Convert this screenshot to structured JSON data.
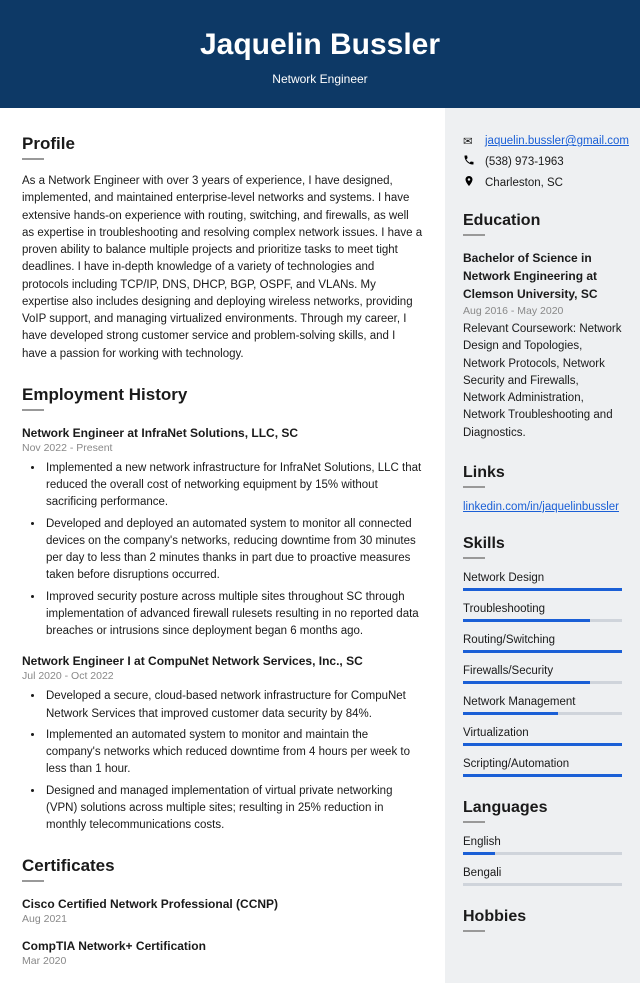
{
  "header": {
    "name": "Jaquelin Bussler",
    "title": "Network Engineer"
  },
  "profile": {
    "heading": "Profile",
    "text": "As a Network Engineer with over 3 years of experience, I have designed, implemented, and maintained enterprise-level networks and systems. I have extensive hands-on experience with routing, switching, and firewalls, as well as expertise in troubleshooting and resolving complex network issues. I have a proven ability to balance multiple projects and prioritize tasks to meet tight deadlines. I have in-depth knowledge of a variety of technologies and protocols including TCP/IP, DNS, DHCP, BGP, OSPF, and VLANs. My expertise also includes designing and deploying wireless networks, providing VoIP support, and managing virtualized environments. Through my career, I have developed strong customer service and problem-solving skills, and I have a passion for working with technology."
  },
  "employment": {
    "heading": "Employment History",
    "jobs": [
      {
        "title": "Network Engineer at InfraNet Solutions, LLC, SC",
        "dates": "Nov 2022 - Present",
        "bullets": [
          "Implemented a new network infrastructure for InfraNet Solutions, LLC that reduced the overall cost of networking equipment by 15% without sacrificing performance.",
          "Developed and deployed an automated system to monitor all connected devices on the company's networks, reducing downtime from 30 minutes per day to less than 2 minutes thanks in part due to proactive measures taken before disruptions occurred.",
          "Improved security posture across multiple sites throughout SC through implementation of advanced firewall rulesets resulting in no reported data breaches or intrusions since deployment began 6 months ago."
        ]
      },
      {
        "title": "Network Engineer I at CompuNet Network Services, Inc., SC",
        "dates": "Jul 2020 - Oct 2022",
        "bullets": [
          "Developed a secure, cloud-based network infrastructure for CompuNet Network Services that improved customer data security by 84%.",
          "Implemented an automated system to monitor and maintain the company's networks which reduced downtime from 4 hours per week to less than 1 hour.",
          "Designed and managed implementation of virtual private networking (VPN) solutions across multiple sites; resulting in 25% reduction in monthly telecommunications costs."
        ]
      }
    ]
  },
  "certificates": {
    "heading": "Certificates",
    "items": [
      {
        "title": "Cisco Certified Network Professional (CCNP)",
        "date": "Aug 2021"
      },
      {
        "title": "CompTIA Network+ Certification",
        "date": "Mar 2020"
      }
    ]
  },
  "contact": {
    "email": "jaquelin.bussler@gmail.com",
    "phone": "(538) 973-1963",
    "location": "Charleston, SC"
  },
  "education": {
    "heading": "Education",
    "title": "Bachelor of Science in Network Engineering at Clemson University, SC",
    "dates": "Aug 2016 - May 2020",
    "desc": "Relevant Coursework: Network Design and Topologies, Network Protocols, Network Security and Firewalls, Network Administration, Network Troubleshooting and Diagnostics."
  },
  "links": {
    "heading": "Links",
    "url": "linkedin.com/in/jaquelinbussler"
  },
  "skills": {
    "heading": "Skills",
    "items": [
      {
        "name": "Network Design",
        "level": 5
      },
      {
        "name": "Troubleshooting",
        "level": 4
      },
      {
        "name": "Routing/Switching",
        "level": 5
      },
      {
        "name": "Firewalls/Security",
        "level": 4
      },
      {
        "name": "Network Management",
        "level": 3
      },
      {
        "name": "Virtualization",
        "level": 5
      },
      {
        "name": "Scripting/Automation",
        "level": 5
      }
    ]
  },
  "languages": {
    "heading": "Languages",
    "items": [
      {
        "name": "English",
        "level": 1
      },
      {
        "name": "Bengali",
        "level": 0
      }
    ]
  },
  "hobbies": {
    "heading": "Hobbies"
  }
}
